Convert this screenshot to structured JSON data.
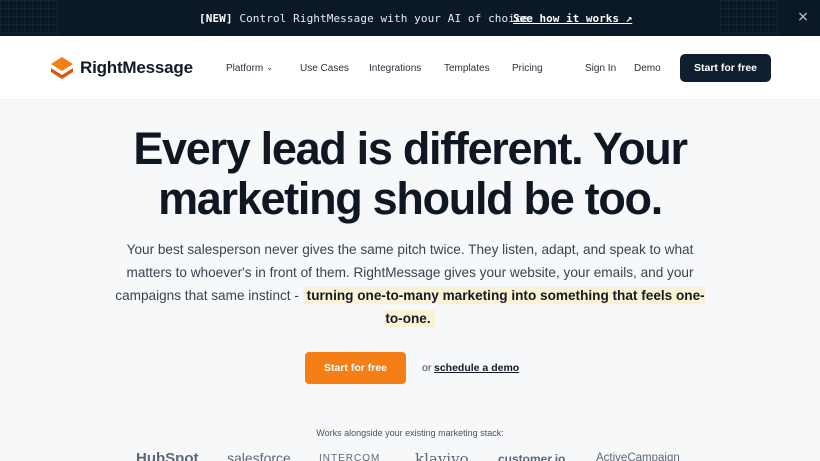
{
  "banner": {
    "tag": "[NEW]",
    "message": " Control RightMessage with your AI of choice",
    "link": "See how it works ↗",
    "close_icon": "×"
  },
  "nav": {
    "brand": "RightMessage",
    "items": [
      {
        "label": "Platform",
        "dropdown": true
      },
      {
        "label": "Use Cases"
      },
      {
        "label": "Integrations"
      },
      {
        "label": "Templates"
      },
      {
        "label": "Pricing"
      }
    ],
    "sign_in": "Sign In",
    "demo": "Demo",
    "cta": "Start for free"
  },
  "hero": {
    "headline_line1": "Every lead is different. Your",
    "headline_line2": "marketing should be too.",
    "sub_before": "Your best salesperson never gives the same pitch twice. They listen, adapt, and speak to what matters to whoever's in front of them. RightMessage gives your website, your emails, and your campaigns that same instinct - ",
    "sub_highlight": "turning one-to-many marketing into something that feels one-to-one.",
    "cta": "Start for free",
    "or": "or",
    "demo_link": "schedule a demo"
  },
  "stack": {
    "label": "Works alongside your existing marketing stack:",
    "logos": [
      "HubSpot",
      "salesforce",
      "INTERCOM",
      "klaviyo",
      "customer.io",
      "ActiveCampaign"
    ]
  },
  "colors": {
    "banner_bg": "#0b1826",
    "nav_cta_bg": "#0f1f30",
    "accent_orange": "#f57f17",
    "highlight_bg": "#fbf1d4"
  }
}
